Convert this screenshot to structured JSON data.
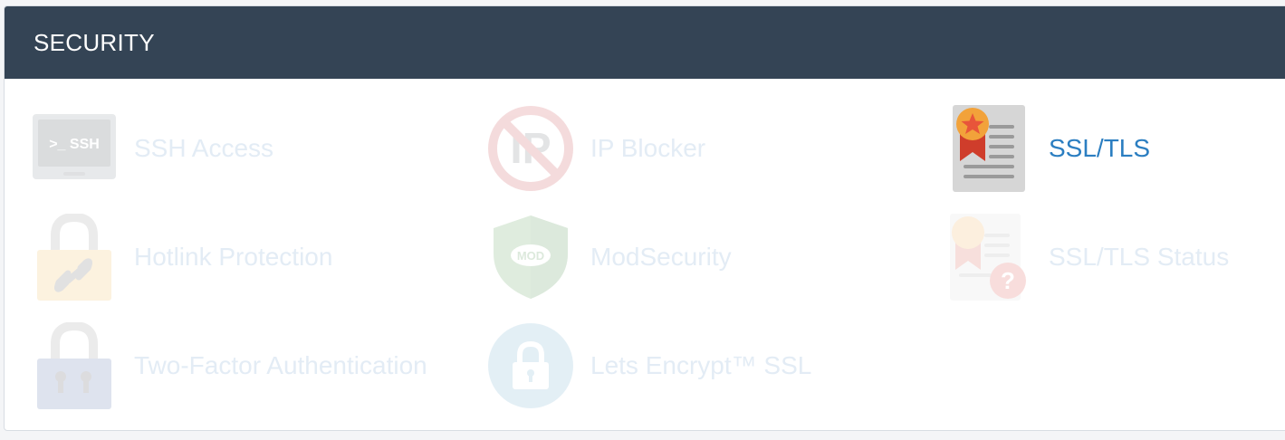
{
  "section": {
    "title": "SECURITY"
  },
  "items": [
    {
      "label": "SSH Access",
      "icon": "ssh-terminal-icon",
      "icon_text": ">_ SSH",
      "state": "disabled"
    },
    {
      "label": "IP Blocker",
      "icon": "ip-blocker-icon",
      "icon_text": "IP",
      "state": "disabled"
    },
    {
      "label": "SSL/TLS",
      "icon": "ssl-certificate-icon",
      "state": "enabled"
    },
    {
      "label": "Hotlink Protection",
      "icon": "hotlink-lock-icon",
      "state": "disabled"
    },
    {
      "label": "ModSecurity",
      "icon": "modsecurity-shield-icon",
      "icon_text": "MOD",
      "state": "disabled"
    },
    {
      "label": "SSL/TLS Status",
      "icon": "ssl-status-icon",
      "state": "disabled"
    },
    {
      "label": "Two-Factor Authentication",
      "icon": "two-factor-lock-icon",
      "state": "disabled"
    },
    {
      "label": "Lets Encrypt™ SSL",
      "icon": "lets-encrypt-lock-icon",
      "state": "disabled"
    }
  ],
  "colors": {
    "header_bg": "#344455",
    "header_text": "#ffffff",
    "active_link": "#2b7ec1",
    "disabled_text": "#e3ecf5"
  }
}
